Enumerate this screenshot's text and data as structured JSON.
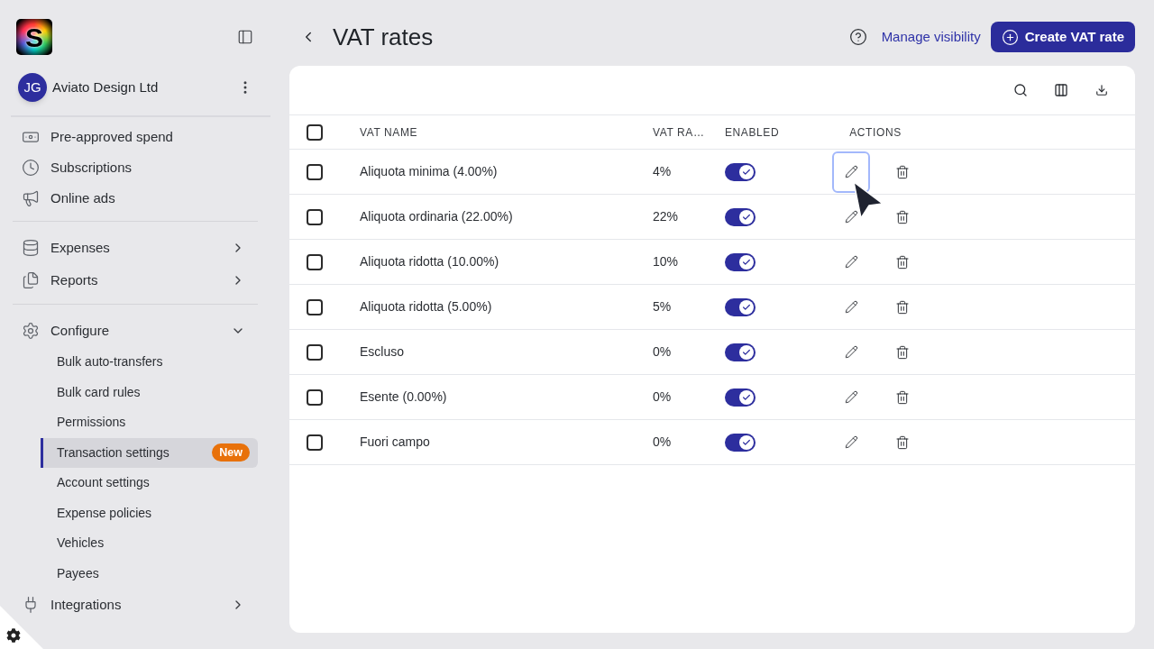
{
  "sidebar": {
    "logo": "S",
    "account": {
      "initials": "JG",
      "name": "Aviato Design Ltd"
    },
    "sections": [
      {
        "items": [
          {
            "kind": "link",
            "label": "Pre-approved spend"
          },
          {
            "kind": "link",
            "label": "Subscriptions"
          },
          {
            "kind": "link",
            "label": "Online ads"
          }
        ]
      },
      {
        "items": [
          {
            "kind": "group",
            "label": "Expenses",
            "expanded": false
          },
          {
            "kind": "group",
            "label": "Reports",
            "expanded": false
          }
        ]
      },
      {
        "items": [
          {
            "kind": "group",
            "label": "Configure",
            "expanded": true,
            "children": [
              {
                "label": "Bulk auto-transfers",
                "selected": false
              },
              {
                "label": "Bulk card rules",
                "selected": false
              },
              {
                "label": "Permissions",
                "selected": false
              },
              {
                "label": "Transaction settings",
                "selected": true,
                "badge": "New"
              },
              {
                "label": "Account settings",
                "selected": false
              },
              {
                "label": "Expense policies",
                "selected": false
              },
              {
                "label": "Vehicles",
                "selected": false
              },
              {
                "label": "Payees",
                "selected": false
              }
            ]
          },
          {
            "kind": "group",
            "label": "Integrations",
            "expanded": false
          }
        ]
      }
    ]
  },
  "header": {
    "title": "VAT rates",
    "link": "Manage visibility",
    "primary_button": "Create VAT rate"
  },
  "table": {
    "select_all": {
      "checked": false
    },
    "columns": [
      "VAT NAME",
      "VAT RA…",
      "ENABLED",
      "ACTIONS"
    ],
    "rows": [
      {
        "checked": false,
        "name": "Aliquota minima (4.00%)",
        "rate": "4%",
        "enabled": true,
        "edit_focused": true
      },
      {
        "checked": false,
        "name": "Aliquota ordinaria (22.00%)",
        "rate": "22%",
        "enabled": true,
        "edit_focused": false
      },
      {
        "checked": false,
        "name": "Aliquota ridotta (10.00%)",
        "rate": "10%",
        "enabled": true,
        "edit_focused": false
      },
      {
        "checked": false,
        "name": "Aliquota ridotta (5.00%)",
        "rate": "5%",
        "enabled": true,
        "edit_focused": false
      },
      {
        "checked": false,
        "name": "Escluso",
        "rate": "0%",
        "enabled": true,
        "edit_focused": false
      },
      {
        "checked": false,
        "name": "Esente (0.00%)",
        "rate": "0%",
        "enabled": true,
        "edit_focused": false
      },
      {
        "checked": false,
        "name": "Fuori campo",
        "rate": "0%",
        "enabled": true,
        "edit_focused": false
      }
    ]
  }
}
